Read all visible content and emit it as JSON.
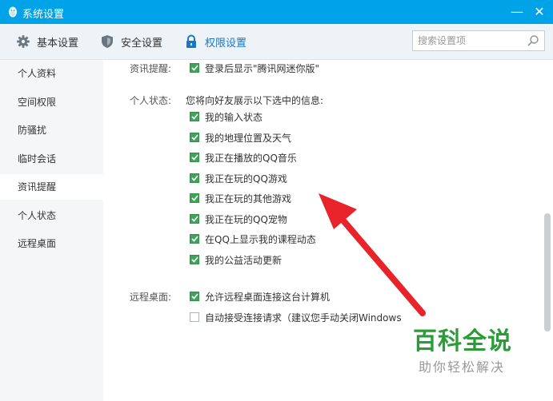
{
  "window": {
    "title": "系统设置",
    "min_glyph": "—",
    "close_glyph": "✕"
  },
  "toolbar": {
    "tabs": [
      {
        "label": "基本设置",
        "icon": "gear-icon"
      },
      {
        "label": "安全设置",
        "icon": "shield-icon"
      },
      {
        "label": "权限设置",
        "icon": "lock-icon",
        "active": true
      }
    ],
    "search_placeholder": "搜索设置项"
  },
  "sidebar": {
    "items": [
      {
        "label": "个人资料"
      },
      {
        "label": "空间权限"
      },
      {
        "label": "防骚扰"
      },
      {
        "label": "临时会话"
      },
      {
        "label": "资讯提醒",
        "active": true
      },
      {
        "label": "个人状态"
      },
      {
        "label": "远程桌面"
      }
    ]
  },
  "content": {
    "news": {
      "label": "资讯提醒:",
      "option": {
        "text": "登录后显示\"腾讯网迷你版\"",
        "checked": true
      }
    },
    "status": {
      "label": "个人状态:",
      "description": "您将向好友展示以下选中的信息:",
      "options": [
        {
          "text": "我的输入状态",
          "checked": true
        },
        {
          "text": "我的地理位置及天气",
          "checked": true
        },
        {
          "text": "我正在播放的QQ音乐",
          "checked": true
        },
        {
          "text": "我正在玩的QQ游戏",
          "checked": true
        },
        {
          "text": "我正在玩的其他游戏",
          "checked": true
        },
        {
          "text": "我正在玩的QQ宠物",
          "checked": true
        },
        {
          "text": "在QQ上显示我的课程动态",
          "checked": true
        },
        {
          "text": "我的公益活动更新",
          "checked": true
        }
      ]
    },
    "remote": {
      "label": "远程桌面:",
      "options": [
        {
          "text": "允许远程桌面连接这台计算机",
          "checked": true
        },
        {
          "text": "自动接受连接请求（建议您手动关闭Windows",
          "checked": false
        }
      ]
    }
  },
  "watermark": {
    "title": "百科全说",
    "subtitle": "助你轻松解决"
  },
  "colors": {
    "titlebar": "#00a2e8",
    "accent": "#1878c8",
    "check": "#3fa35a",
    "arrow": "#e8242a"
  }
}
